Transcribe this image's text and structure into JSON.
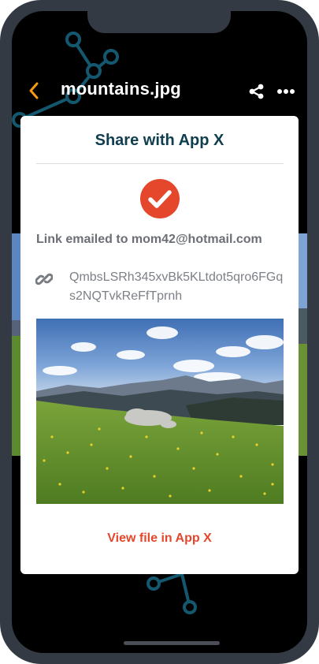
{
  "file": {
    "name": "mountains.jpg"
  },
  "share_dialog": {
    "title": "Share with App X",
    "status": "Link emailed to mom42@hotmail.com",
    "link": "QmbsLSRh345xvBk5KLtdot5qro6FGqs2NQTvkReFfTprnh",
    "view_link_label": "View file in App X"
  },
  "icons": {
    "back": "chevron-left-icon",
    "share": "share-icon",
    "more": "more-horizontal-icon",
    "success": "checkmark-circle-icon",
    "link": "link-icon"
  },
  "colors": {
    "accent": "#e4472b",
    "back_arrow": "#f39c12",
    "title": "#0f3e4e",
    "network_graphic": "#14586f",
    "phone_frame": "#333a44"
  }
}
